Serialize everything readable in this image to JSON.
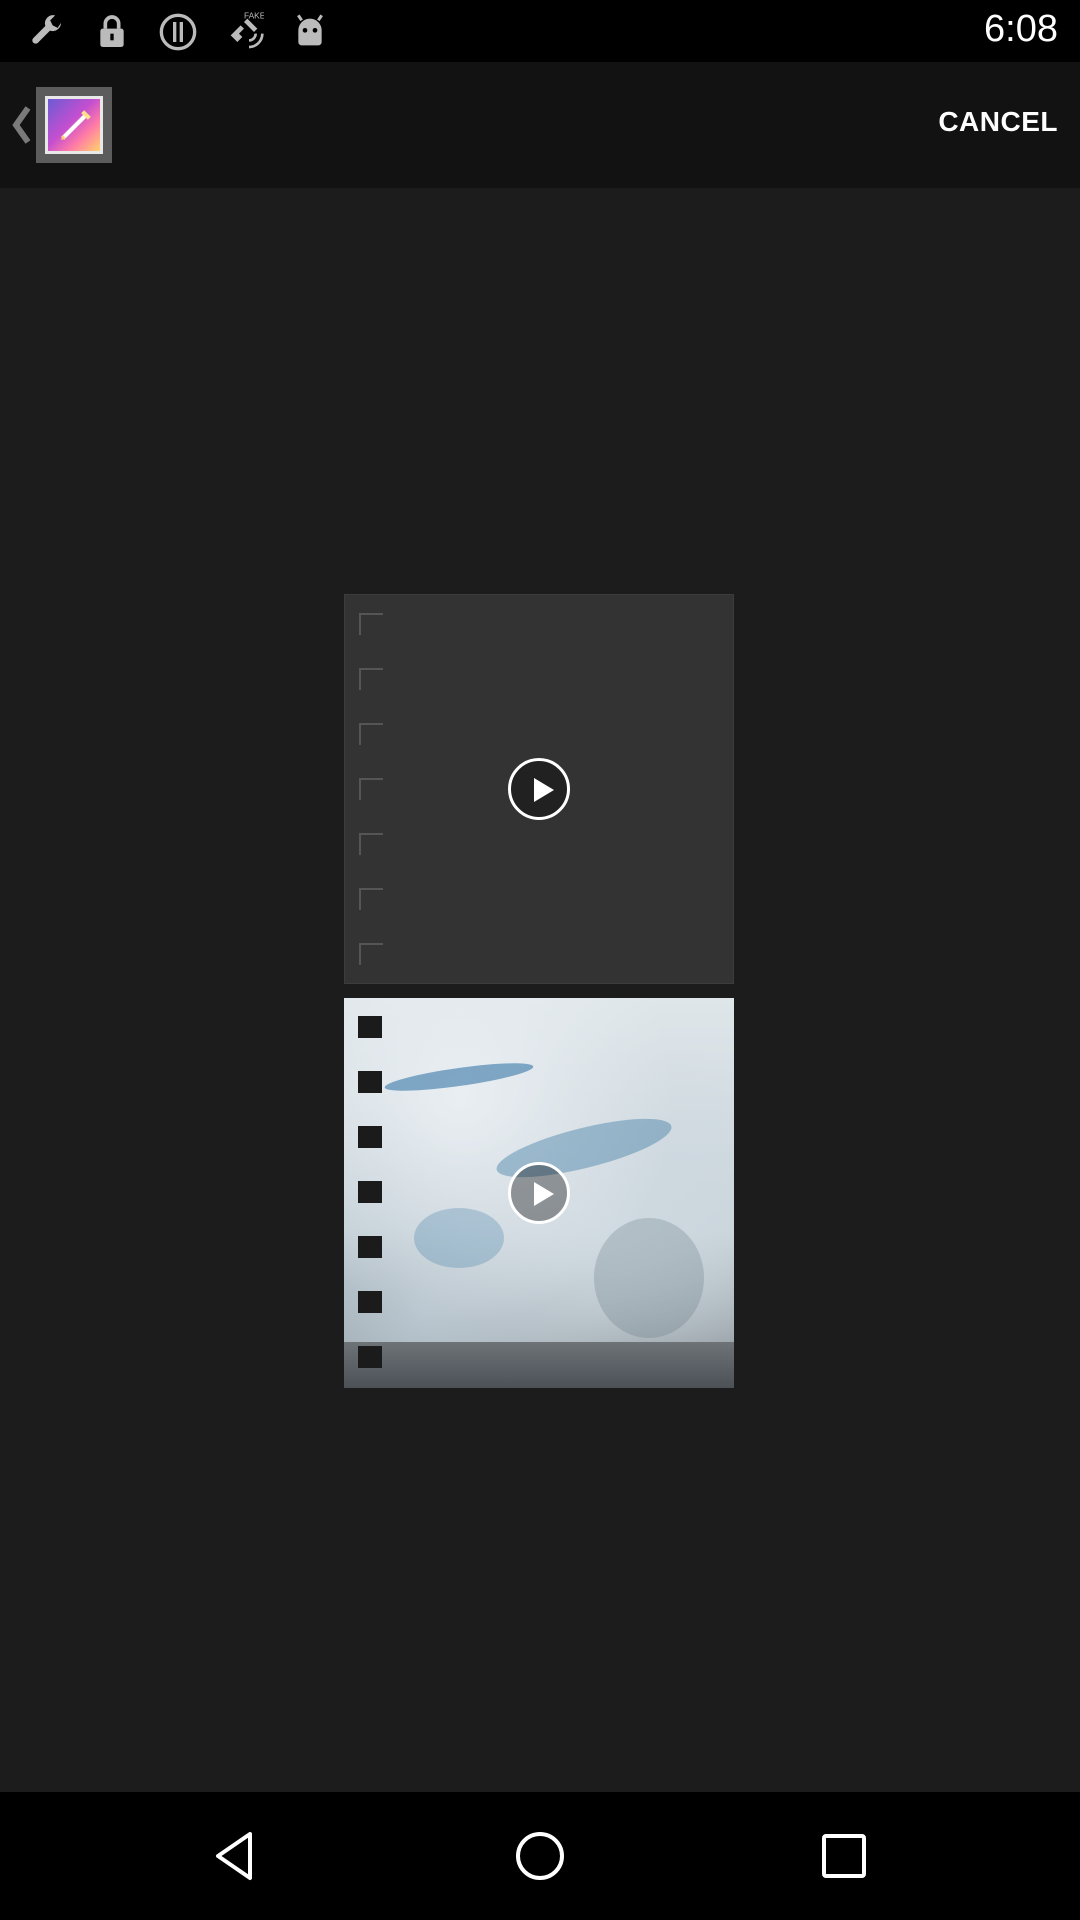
{
  "status_bar": {
    "time": "6:08",
    "icons": [
      "wrench-icon",
      "lock-icon",
      "alert-icon",
      "fake-gps-icon",
      "android-icon"
    ]
  },
  "action_bar": {
    "cancel_label": "CANCEL",
    "app_icon": "gallery-icon"
  },
  "thumbnails": [
    {
      "kind": "video",
      "preview": "blank-dark",
      "icon": "play-icon"
    },
    {
      "kind": "video",
      "preview": "glacier",
      "icon": "play-icon"
    }
  ],
  "nav_bar": {
    "buttons": [
      "back-icon",
      "home-icon",
      "recents-icon"
    ]
  },
  "colors": {
    "background": "#1c1c1c",
    "action_bar": "#121212",
    "status_bar": "#000000"
  }
}
